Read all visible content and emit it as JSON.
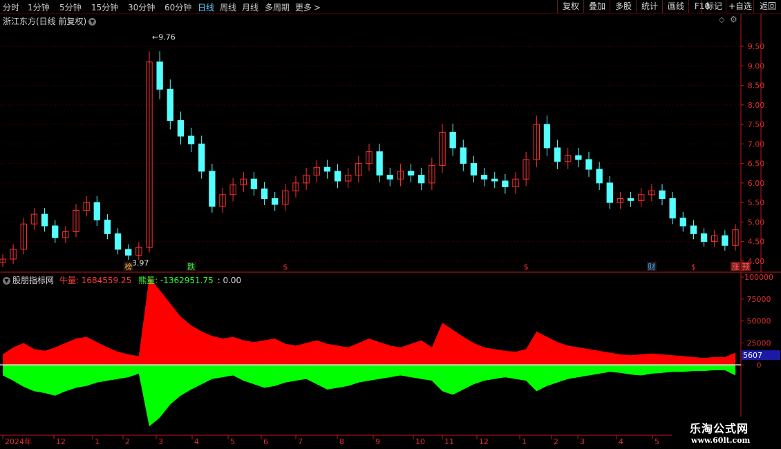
{
  "toolbar": {
    "periods": [
      "分时",
      "1分钟",
      "5分钟",
      "15分钟",
      "30分钟",
      "60分钟",
      "日线",
      "周线",
      "月线",
      "多周期",
      "更多"
    ],
    "active_period": "日线",
    "more_arrow": ">",
    "buttons": [
      "复权",
      "叠加",
      "多股",
      "统计",
      "画线",
      "F10",
      "标记",
      "+自选",
      "返回"
    ]
  },
  "main_title": "浙江东方(日线 前复权)",
  "indicator": {
    "name": "股朋指标网",
    "bull_label": "牛量: 1684559.25",
    "bear_label": "熊量: -1362951.75",
    "extra_label": ": 0.00",
    "current_value_badge": "5607"
  },
  "price_annotations": {
    "high": "9.76",
    "low": "3.97"
  },
  "event_markers": [
    {
      "label": "榜",
      "date_index": 12,
      "color": "#ff9f40"
    },
    {
      "label": "跌",
      "date_index": 18,
      "color": "#33ff33"
    },
    {
      "label": "$",
      "date_index": 27,
      "color": "#ff3030"
    },
    {
      "label": "$",
      "date_index": 50,
      "color": "#ff3030"
    },
    {
      "label": "财",
      "date_index": 62,
      "color": "#4aa8ff"
    },
    {
      "label": "$",
      "date_index": 66,
      "color": "#ff3030"
    },
    {
      "label": "涨",
      "date_index": 70,
      "color": "#ff6060"
    },
    {
      "label": "预",
      "date_index": 71,
      "color": "#ff6060"
    }
  ],
  "date_axis": [
    "2024年",
    "12",
    "1",
    "2",
    "3",
    "4",
    "5",
    "6",
    "7",
    "8",
    "9",
    "10",
    "11",
    "12",
    "1",
    "2",
    "3",
    "4",
    "5"
  ],
  "watermark": {
    "line1": "乐淘公式网",
    "line2": "www.60lt.com"
  },
  "colors": {
    "up": "#ff3232",
    "down": "#54ffff",
    "bull": "#ff0000",
    "bear": "#00ff00",
    "grid": "#5a0000",
    "axis": "#c01818",
    "badge": "#1a1aa6"
  },
  "chart_data": [
    {
      "type": "candlestick",
      "title": "浙江东方(日线 前复权)",
      "y_ticks": [
        4.0,
        4.5,
        5.0,
        5.5,
        6.0,
        6.5,
        7.0,
        7.5,
        8.0,
        8.5,
        9.0,
        9.5
      ],
      "ylim": [
        3.75,
        10.05
      ],
      "series": [
        {
          "name": "close",
          "values": [
            4.05,
            4.3,
            4.95,
            5.2,
            4.9,
            4.6,
            4.75,
            5.3,
            5.5,
            5.05,
            4.7,
            4.3,
            4.15,
            4.35,
            9.1,
            8.4,
            7.6,
            7.2,
            7.0,
            6.3,
            5.4,
            5.7,
            5.95,
            6.1,
            5.85,
            5.6,
            5.45,
            5.8,
            6.0,
            6.2,
            6.4,
            6.3,
            6.05,
            6.2,
            6.5,
            6.8,
            6.2,
            6.1,
            6.3,
            6.2,
            6.0,
            6.45,
            7.3,
            6.9,
            6.5,
            6.2,
            6.1,
            6.05,
            5.9,
            6.1,
            6.6,
            7.5,
            6.9,
            6.55,
            6.7,
            6.6,
            6.35,
            6.0,
            5.5,
            5.6,
            5.55,
            5.7,
            5.8,
            5.6,
            5.1,
            4.9,
            4.7,
            4.5,
            4.65,
            4.4,
            4.8
          ]
        }
      ],
      "high_label": "9.76",
      "low_label": "3.97"
    },
    {
      "type": "area",
      "title": "股朋指标网",
      "y_ticks": [
        0,
        25000,
        50000,
        75000,
        100000
      ],
      "ylim": [
        -80000,
        104000
      ],
      "series": [
        {
          "name": "牛量",
          "values": [
            12000,
            20000,
            25000,
            18000,
            16000,
            20000,
            25000,
            30000,
            32000,
            26000,
            20000,
            15000,
            12000,
            10000,
            100000,
            85000,
            70000,
            55000,
            45000,
            38000,
            33000,
            30000,
            32000,
            28000,
            26000,
            28000,
            30000,
            24000,
            22000,
            25000,
            28000,
            24000,
            22000,
            20000,
            25000,
            30000,
            26000,
            22000,
            20000,
            24000,
            28000,
            20000,
            48000,
            40000,
            32000,
            25000,
            20000,
            18000,
            16000,
            15000,
            18000,
            38000,
            32000,
            26000,
            22000,
            20000,
            18000,
            16000,
            14000,
            12000,
            11000,
            12000,
            13000,
            12000,
            11000,
            10000,
            9000,
            8000,
            9000,
            9000,
            14000
          ]
        },
        {
          "name": "熊量",
          "values": [
            -12000,
            -18000,
            -25000,
            -30000,
            -32000,
            -35000,
            -30000,
            -26000,
            -24000,
            -20000,
            -18000,
            -16000,
            -14000,
            -10000,
            -70000,
            -60000,
            -45000,
            -35000,
            -28000,
            -22000,
            -16000,
            -14000,
            -12000,
            -18000,
            -22000,
            -26000,
            -24000,
            -20000,
            -18000,
            -16000,
            -22000,
            -28000,
            -26000,
            -24000,
            -20000,
            -18000,
            -16000,
            -14000,
            -12000,
            -14000,
            -16000,
            -18000,
            -30000,
            -34000,
            -28000,
            -22000,
            -18000,
            -16000,
            -14000,
            -16000,
            -18000,
            -30000,
            -24000,
            -20000,
            -16000,
            -14000,
            -12000,
            -10000,
            -8000,
            -9000,
            -11000,
            -12000,
            -10000,
            -9000,
            -8000,
            -8000,
            -7000,
            -7000,
            -6000,
            -6000,
            -12000
          ]
        }
      ],
      "current_value": "5607"
    }
  ]
}
